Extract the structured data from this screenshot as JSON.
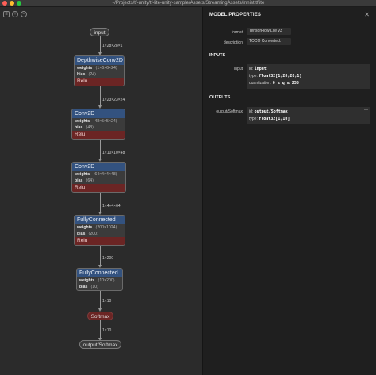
{
  "window": {
    "title": "~/Projects/tf-unity/tf-lite-unity-sample/Assets/StreamingAssets/mnist.tflite"
  },
  "toolbar": {
    "sidebar_icon": "sidebar-icon",
    "zoom_in_icon": "zoom-in-icon",
    "zoom_out_icon": "zoom-out-icon"
  },
  "graph": {
    "input_label": "input",
    "edges": [
      "1×28×28×1",
      "1×23×23×24",
      "1×10×10×48",
      "1×4×4×64",
      "1×200",
      "1×10",
      "1×10"
    ],
    "nodes": [
      {
        "name": "DepthwiseConv2D",
        "weights": "⟨1×6×6×24⟩",
        "bias": "⟨24⟩",
        "activation": "Relu"
      },
      {
        "name": "Conv2D",
        "weights": "⟨48×5×5×24⟩",
        "bias": "⟨48⟩",
        "activation": "Relu"
      },
      {
        "name": "Conv2D",
        "weights": "⟨64×4×4×48⟩",
        "bias": "⟨64⟩",
        "activation": "Relu"
      },
      {
        "name": "FullyConnected",
        "weights": "⟨200×1024⟩",
        "bias": "⟨200⟩",
        "activation": "Relu"
      },
      {
        "name": "FullyConnected",
        "weights": "⟨10×200⟩",
        "bias": "⟨10⟩"
      }
    ],
    "weights_label": "weights",
    "bias_label": "bias",
    "softmax_label": "Softmax",
    "output_label": "output/Softmax"
  },
  "panel": {
    "title": "MODEL PROPERTIES",
    "close_icon": "close-icon",
    "format_label": "format",
    "format_value": "TensorFlow Lite v3",
    "description_label": "description",
    "description_value": "TOCO Converted.",
    "inputs_header": "INPUTS",
    "input_label": "input",
    "input_id_key": "id:",
    "input_id": "input",
    "input_type_key": "type:",
    "input_type": "float32[1,28,28,1]",
    "input_quant_key": "quantization:",
    "input_quant": "0 ≤ q ≤ 255",
    "outputs_header": "OUTPUTS",
    "output_label": "output/Softmax",
    "output_id_key": "id:",
    "output_id": "output/Softmax",
    "output_type_key": "type:",
    "output_type": "float32[1,10]"
  },
  "colors": {
    "node_header": "#33527f",
    "activation": "#6b2524",
    "panel_bg": "#1f1f1f",
    "canvas_bg": "#2b2b2b"
  }
}
